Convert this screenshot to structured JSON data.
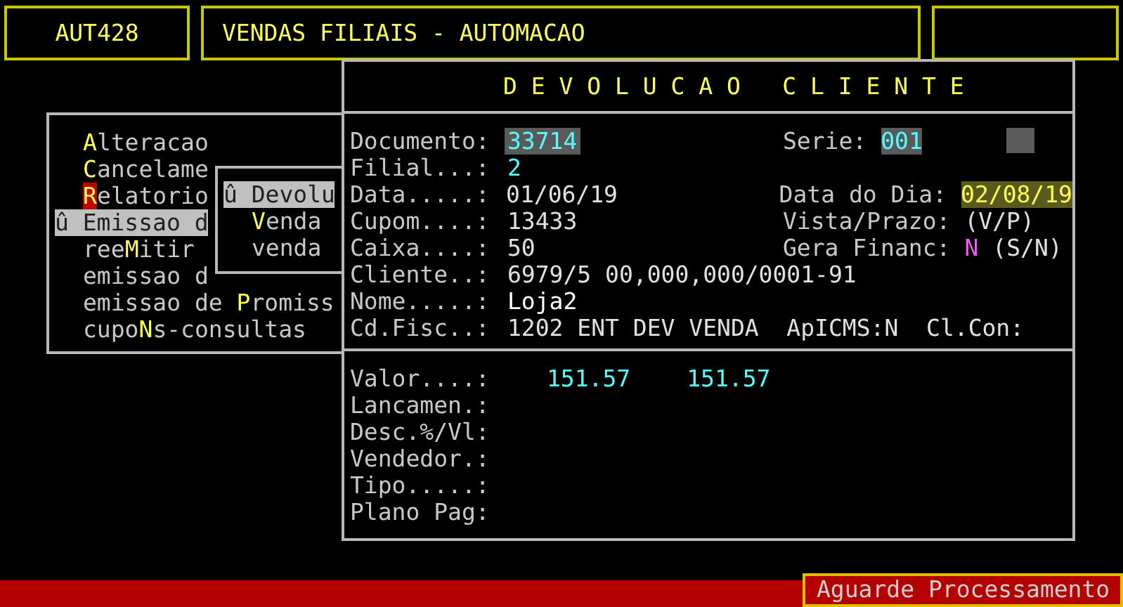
{
  "header": {
    "code": "AUT428",
    "title": "VENDAS FILIAIS - AUTOMACAO"
  },
  "menu": {
    "items": [
      {
        "key": "A",
        "after": "lteracao",
        "selected": false,
        "cursor": false
      },
      {
        "key": "C",
        "after": "ancelame",
        "selected": false,
        "cursor": false
      },
      {
        "key": "R",
        "after": "elatorio",
        "selected": false,
        "cursor": true
      },
      {
        "before": "û Emissao d",
        "selected": true,
        "cursor": false
      },
      {
        "before": "ree",
        "key": "M",
        "after": "itir",
        "selected": false,
        "cursor": false
      },
      {
        "before": "emissao d",
        "selected": false,
        "cursor": false
      },
      {
        "before": "emissao de ",
        "key": "P",
        "after": "romiss",
        "selected": false,
        "cursor": false
      },
      {
        "before": "cupo",
        "key": "N",
        "after": "s-consultas",
        "selected": false,
        "cursor": false
      }
    ]
  },
  "submenu": {
    "items": [
      {
        "before": "û Devolu",
        "selected": true
      },
      {
        "key": "V",
        "after": "enda",
        "selected": false
      },
      {
        "before": "venda",
        "selected": false
      }
    ]
  },
  "dialog": {
    "title": "D E V O L U C A O   C L I E N T E",
    "fields": [
      {
        "label": "Documento:",
        "value": "33714",
        "kind": "highlighted",
        "right": [
          {
            "label": "Serie:",
            "value": "001",
            "kind": "highlighted"
          },
          {
            "kind": "square"
          }
        ]
      },
      {
        "label": "Filial...:",
        "value": "2",
        "kind": "accent"
      },
      {
        "label": "Data.....:",
        "value": "01/06/19",
        "kind": "plain",
        "right": [
          {
            "label": "Data do Dia:",
            "value": "02/08/19",
            "kind": "date"
          }
        ]
      },
      {
        "label": "Cupom....:",
        "value": "13433",
        "kind": "plain",
        "right": [
          {
            "label": "Vista/Prazo:",
            "value": "(V/P)",
            "kind": "plain"
          }
        ]
      },
      {
        "label": "Caixa....:",
        "value": "50",
        "kind": "plain",
        "right": [
          {
            "label": "Gera Financ:",
            "value": "N",
            "kind": "flag"
          },
          {
            "value": "(S/N)",
            "kind": "plain"
          }
        ]
      },
      {
        "label": "Cliente..:",
        "value": "6979/5 00,000,000/0001-91",
        "kind": "plain"
      },
      {
        "label": "Nome.....:",
        "value": "Loja2",
        "kind": "bright"
      },
      {
        "label": "Cd.Fisc..:",
        "value": "1202 ENT DEV VENDA  ApICMS:N  Cl.Con:",
        "kind": "plain"
      }
    ],
    "totals": [
      {
        "label": "Valor....:",
        "values": [
          "151.57",
          "151.57"
        ]
      },
      {
        "label": "Lancamen.:"
      },
      {
        "label": "Desc.%/Vl:"
      },
      {
        "label": "Vendedor.:"
      },
      {
        "label": "Tipo.....:"
      },
      {
        "label": "Plano Pag:"
      }
    ]
  },
  "status_bar": {
    "message": "Aguarde Processamento"
  }
}
